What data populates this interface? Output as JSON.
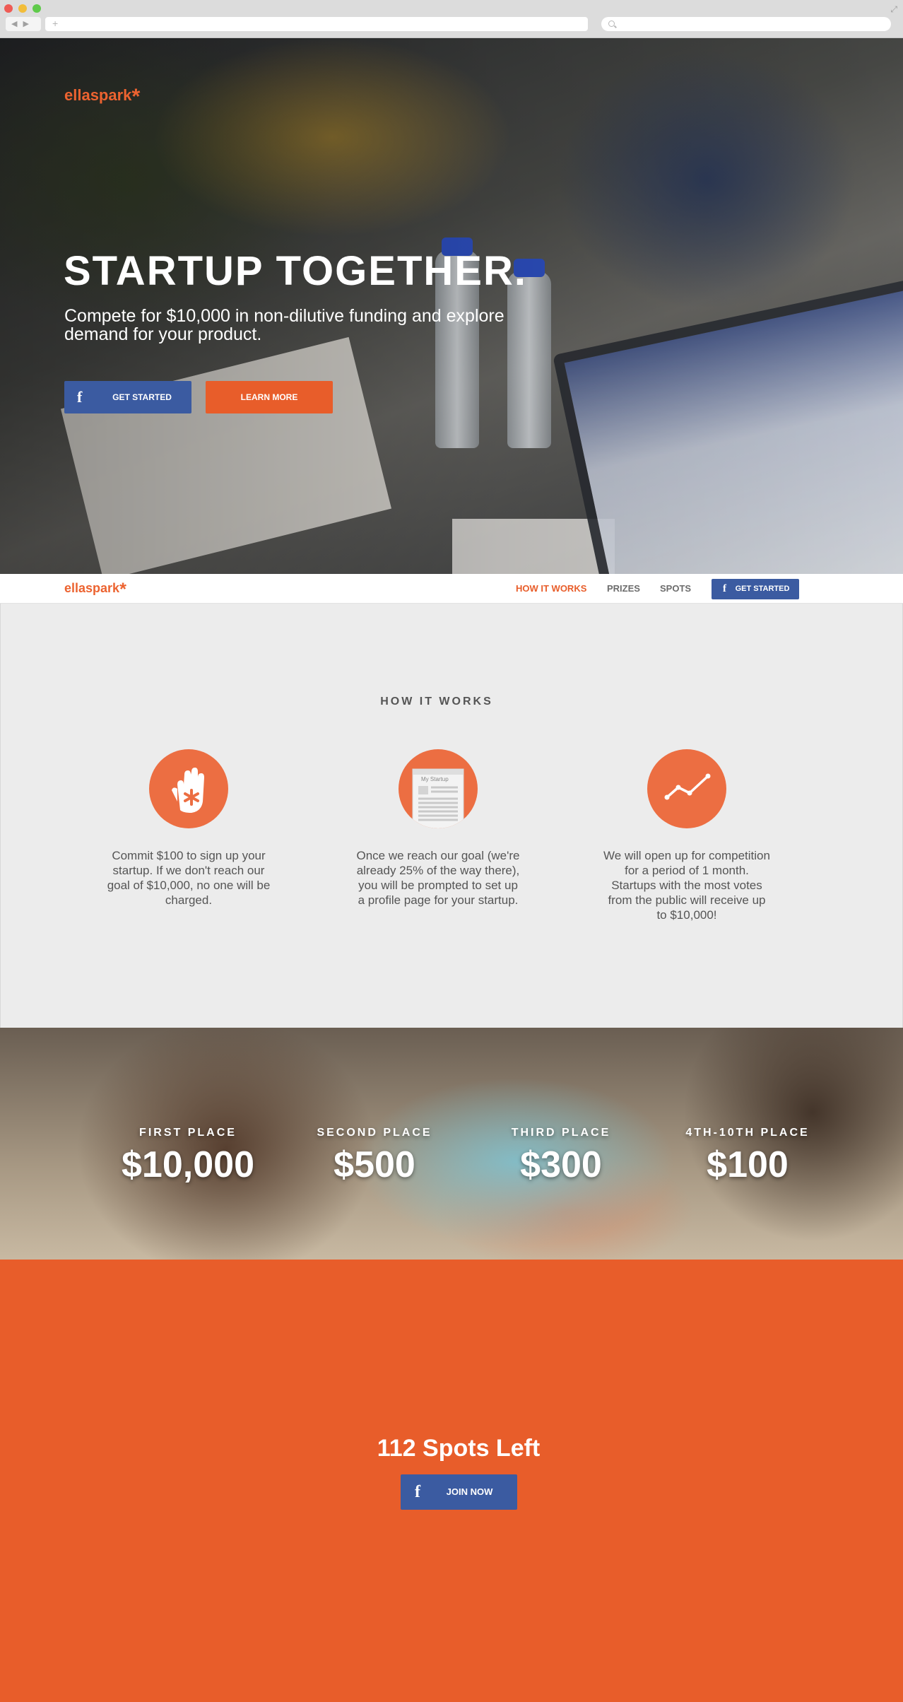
{
  "browser": {
    "nav_buttons": "◀▶",
    "new_tab": "+",
    "expand_icon": "⤢"
  },
  "brand": {
    "name": "ellaspark",
    "star": "*",
    "accent_color": "#e85d2a",
    "facebook_color": "#3b5ba1"
  },
  "hero": {
    "title": "STARTUP TOGETHER.",
    "subtitle": "Compete for $10,000 in non-dilutive funding and explore demand for your product.",
    "get_started_label": "GET STARTED",
    "learn_more_label": "LEARN MORE",
    "facebook_icon": "f"
  },
  "nav": {
    "links": [
      {
        "label": "HOW IT WORKS",
        "active": true
      },
      {
        "label": "PRIZES",
        "active": false
      },
      {
        "label": "SPOTS",
        "active": false
      }
    ],
    "get_started_label": "GET STARTED",
    "facebook_icon": "f"
  },
  "how_it_works": {
    "title": "HOW IT WORKS",
    "steps": [
      {
        "icon": "hand-icon",
        "text": "Commit $100 to sign up your startup. If we don't reach our goal of $10,000, no one will be charged."
      },
      {
        "icon": "profile-page-icon",
        "mini_label": "My Startup",
        "text": "Once we reach our goal (we're already 25% of the way there), you will be prompted to set up a profile page for your startup."
      },
      {
        "icon": "trend-chart-icon",
        "text": "We will open up for competition for a period of 1 month. Startups with the most votes from the public will receive up to $10,000!"
      }
    ]
  },
  "prizes": [
    {
      "label": "FIRST PLACE",
      "amount": "$10,000"
    },
    {
      "label": "SECOND PLACE",
      "amount": "$500"
    },
    {
      "label": "THIRD PLACE",
      "amount": "$300"
    },
    {
      "label": "4TH-10TH PLACE",
      "amount": "$100"
    }
  ],
  "spots": {
    "title": "112 Spots Left",
    "join_label": "JOIN NOW",
    "facebook_icon": "f"
  }
}
